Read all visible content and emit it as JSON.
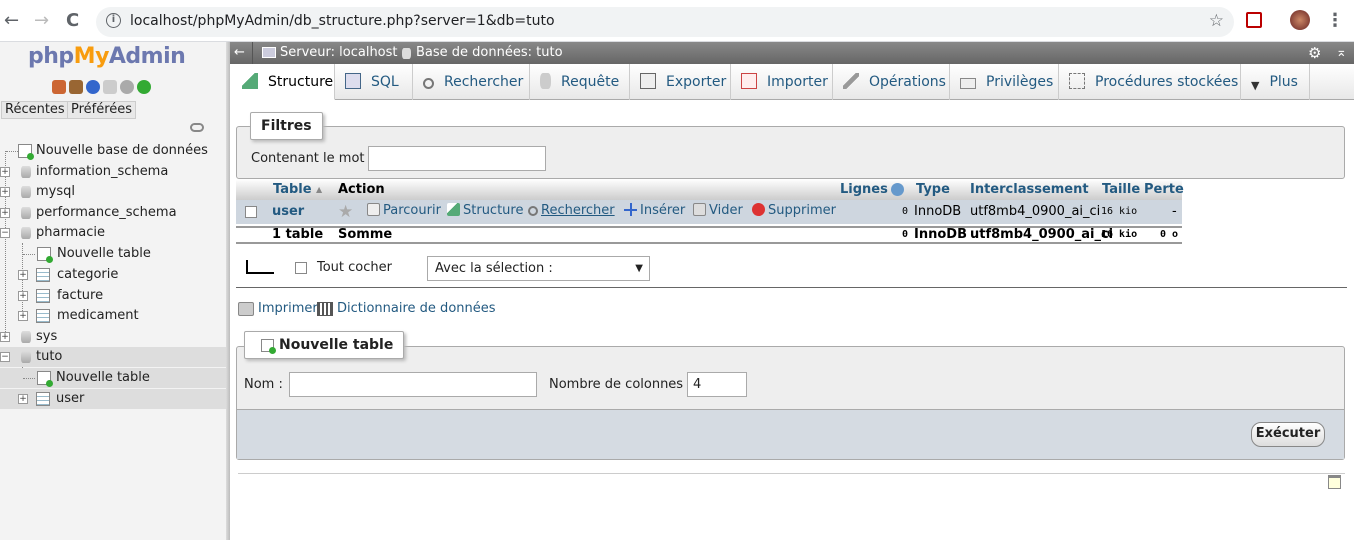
{
  "browser": {
    "url": "localhost/phpMyAdmin/db_structure.php?server=1&db=tuto",
    "nav": {
      "back": "←",
      "forward": "→",
      "reload": "C"
    }
  },
  "sidebar": {
    "logo": {
      "php": "php",
      "my": "My",
      "admin": "Admin"
    },
    "buttons": {
      "recent": "Récentes",
      "favorites": "Préférées"
    },
    "tree": [
      {
        "label": "Nouvelle base de données",
        "type": "new"
      },
      {
        "label": "information_schema",
        "type": "db"
      },
      {
        "label": "mysql",
        "type": "db"
      },
      {
        "label": "performance_schema",
        "type": "db"
      },
      {
        "label": "pharmacie",
        "type": "db"
      },
      {
        "label": "Nouvelle table",
        "type": "new-table"
      },
      {
        "label": "categorie",
        "type": "table"
      },
      {
        "label": "facture",
        "type": "table"
      },
      {
        "label": "medicament",
        "type": "table"
      },
      {
        "label": "sys",
        "type": "db"
      },
      {
        "label": "tuto",
        "type": "db"
      },
      {
        "label": "Nouvelle table",
        "type": "new-table"
      },
      {
        "label": "user",
        "type": "table"
      }
    ]
  },
  "topbar": {
    "server": "Serveur: localhost »",
    "database": "Base de données: tuto"
  },
  "tabs": [
    {
      "label": "Structure"
    },
    {
      "label": "SQL"
    },
    {
      "label": "Rechercher"
    },
    {
      "label": "Requête"
    },
    {
      "label": "Exporter"
    },
    {
      "label": "Importer"
    },
    {
      "label": "Opérations"
    },
    {
      "label": "Privilèges"
    },
    {
      "label": "Procédures stockées"
    },
    {
      "label": "Plus"
    }
  ],
  "filters": {
    "legend": "Filtres",
    "label": "Contenant le mot :",
    "value": ""
  },
  "table": {
    "headers": {
      "table": "Table",
      "sort": "▲",
      "action": "Action",
      "rows": "Lignes",
      "type": "Type",
      "collation": "Interclassement",
      "size": "Taille",
      "overhead": "Perte"
    },
    "row": {
      "name": "user",
      "actions": {
        "browse": "Parcourir",
        "structure": "Structure",
        "search": "Rechercher",
        "insert": "Insérer",
        "empty": "Vider",
        "drop": "Supprimer"
      },
      "rows": "0",
      "type": "InnoDB",
      "collation": "utf8mb4_0900_ai_ci",
      "size": "16 kio",
      "overhead": "-"
    },
    "footer": {
      "count": "1 table",
      "sum": "Somme",
      "rows": "0",
      "type": "InnoDB",
      "collation": "utf8mb4_0900_ai_ci",
      "size": "16 kio",
      "overhead": "0 o"
    }
  },
  "bulk": {
    "check_all": "Tout cocher",
    "with_selected": "Avec la sélection :"
  },
  "links": {
    "print": "Imprimer",
    "dictionary": "Dictionnaire de données"
  },
  "new_table": {
    "legend": "Nouvelle table",
    "name_label": "Nom :",
    "name_value": "",
    "columns_label": "Nombre de colonnes :",
    "columns_value": "4",
    "submit": "Exécuter"
  }
}
